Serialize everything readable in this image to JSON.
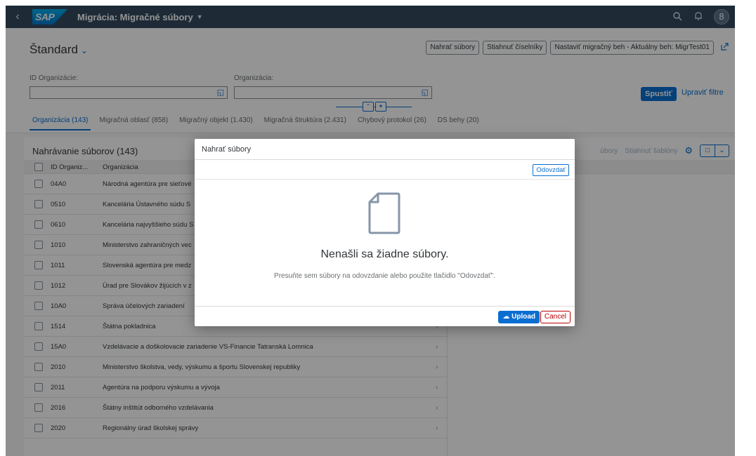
{
  "shell": {
    "title": "Migrácia: Migračné súbory",
    "logo_text": "SAP",
    "avatar_initial": "8"
  },
  "header": {
    "variant": "Štandard",
    "buttons": [
      "Nahrať súbory",
      "Stiahnuť číselníky",
      "Nastaviť migračný beh - Aktuálny beh: MigrTest01"
    ]
  },
  "filters": {
    "id_label": "ID Organizácie:",
    "org_label": "Organizácia:",
    "run_label": "Spustiť",
    "edit_label": "Upraviť filtre"
  },
  "tabs": [
    {
      "label": "Organizácia (143)",
      "active": true
    },
    {
      "label": "Migračná oblasť (858)"
    },
    {
      "label": "Migračný objekt (1.430)"
    },
    {
      "label": "Migračná štruktúra (2.431)"
    },
    {
      "label": "Chybový protokol (26)"
    },
    {
      "label": "DS behy (20)"
    }
  ],
  "table": {
    "title": "Nahrávanie súborov (143)",
    "tool_1": "úbory",
    "tool_2": "Stiahnuť šablóny",
    "columns": [
      "ID Organiz...",
      "Organizácia"
    ],
    "rows": [
      {
        "id": "04A0",
        "org": "Národná agentúra pre sieťové"
      },
      {
        "id": "0510",
        "org": "Kancelária Ústavného súdu S"
      },
      {
        "id": "0610",
        "org": "Kancelária najvyššieho súdu S"
      },
      {
        "id": "1010",
        "org": "Ministerstvo zahraničných vec"
      },
      {
        "id": "1011",
        "org": "Slovenská agentúra pre medz"
      },
      {
        "id": "1012",
        "org": "Úrad pre Slovákov žijúcich v z"
      },
      {
        "id": "10A0",
        "org": "Správa účelových zariadení"
      },
      {
        "id": "1514",
        "org": "Štátna pokladnica"
      },
      {
        "id": "15A0",
        "org": "Vzdelávacie a doškolovacie zariadenie VS-Financie Tatranská Lomnica"
      },
      {
        "id": "2010",
        "org": "Ministerstvo školstva, vedy, výskumu a športu Slovenskej republiky"
      },
      {
        "id": "2011",
        "org": "Agentúra na podporu výskumu a vývoja"
      },
      {
        "id": "2016",
        "org": "Štátny inštitút odborného vzdelávania"
      },
      {
        "id": "2020",
        "org": "Regionálny úrad školskej správy"
      }
    ]
  },
  "dialog": {
    "title": "Nahrať súbory",
    "browse_label": "Odovzdať",
    "empty_title": "Nenašli sa žiadne súbory.",
    "empty_hint": "Presuňte sem súbory na odovzdanie alebo použite tlačidlo \"Odovzdať\".",
    "upload_label": "Upload",
    "cancel_label": "Cancel"
  },
  "colors": {
    "shell": "#354a5f",
    "accent": "#0a6ed1",
    "reject": "#bb0000"
  },
  "icons": [
    "back-icon",
    "search-icon",
    "bell-icon",
    "avatar",
    "value-help-icon",
    "share-icon",
    "gear-icon",
    "document-icon",
    "upload-icon"
  ]
}
